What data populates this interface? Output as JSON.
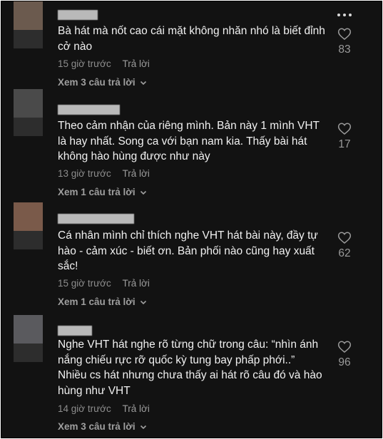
{
  "comments": [
    {
      "text": "Bà hát mà nốt cao cái mặt không nhăn nhó là biết đỉnh cở nào",
      "time": "15 giờ trước",
      "reply_label": "Trả lời",
      "view_replies": "Xem 3 câu trả lời",
      "likes": "83",
      "avatar_color": "#6b5a4e"
    },
    {
      "text": "Theo cảm nhận của riêng mình. Bản này 1 mình VHT là hay nhất. Song ca với bạn nam kia. Thấy bài hát không hào hùng được như này",
      "time": "13 giờ trước",
      "reply_label": "Trả lời",
      "view_replies": "Xem 1 câu trả lời",
      "likes": "17",
      "avatar_color": "#4a4a4a"
    },
    {
      "text": "Cá nhân mình chỉ thích nghe VHT hát bài này, đầy tự hào - cảm xúc - biết ơn. Bản phối nào cũng hay xuất sắc!",
      "time": "15 giờ trước",
      "reply_label": "Trả lời",
      "view_replies": "Xem 1 câu trả lời",
      "likes": "62",
      "avatar_color": "#7a5a4a"
    },
    {
      "text": "Nghe VHT hát nghe rõ từng chữ trong câu: “nhìn ánh nắng chiếu rực rỡ quốc kỳ tung bay phấp phới..” Nhiều cs hát nhưng chưa thấy ai hát rõ câu đó và hào hùng như VHT",
      "time": "14 giờ trước",
      "reply_label": "Trả lời",
      "view_replies": "Xem 3 câu trả lời",
      "likes": "96",
      "avatar_color": "#5a5a5e"
    }
  ],
  "colors": {
    "background": "#121212",
    "text": "#f1f1f1",
    "muted": "#8d8d8d"
  },
  "icons": [
    "more-options-icon",
    "heart-icon",
    "chevron-down-icon"
  ]
}
